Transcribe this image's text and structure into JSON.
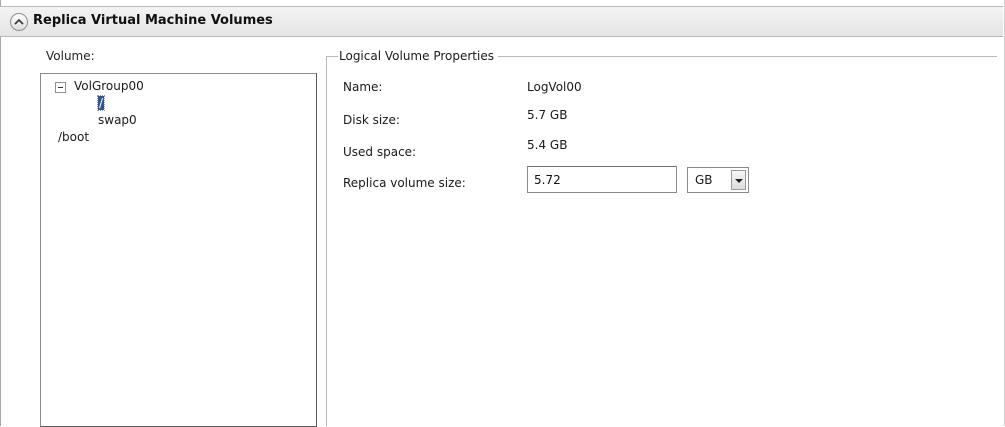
{
  "panel": {
    "title": "Replica Virtual Machine Volumes"
  },
  "volume_section": {
    "label": "Volume:",
    "tree": {
      "root": "VolGroup00",
      "children": [
        "/",
        "swap0"
      ],
      "siblings": [
        "/boot"
      ],
      "selected": "/"
    }
  },
  "properties": {
    "legend": "Logical Volume Properties",
    "name_label": "Name:",
    "name_value": "LogVol00",
    "disk_size_label": "Disk size:",
    "disk_size_value": "5.7 GB",
    "used_space_label": "Used space:",
    "used_space_value": "5.4 GB",
    "replica_size_label": "Replica volume size:",
    "replica_size_value": "5.72",
    "unit_selected": "GB"
  },
  "icons": {
    "collapse": "chevron-up-icon",
    "tree_toggle": "minus-box-icon",
    "dropdown": "chevron-down-icon"
  }
}
